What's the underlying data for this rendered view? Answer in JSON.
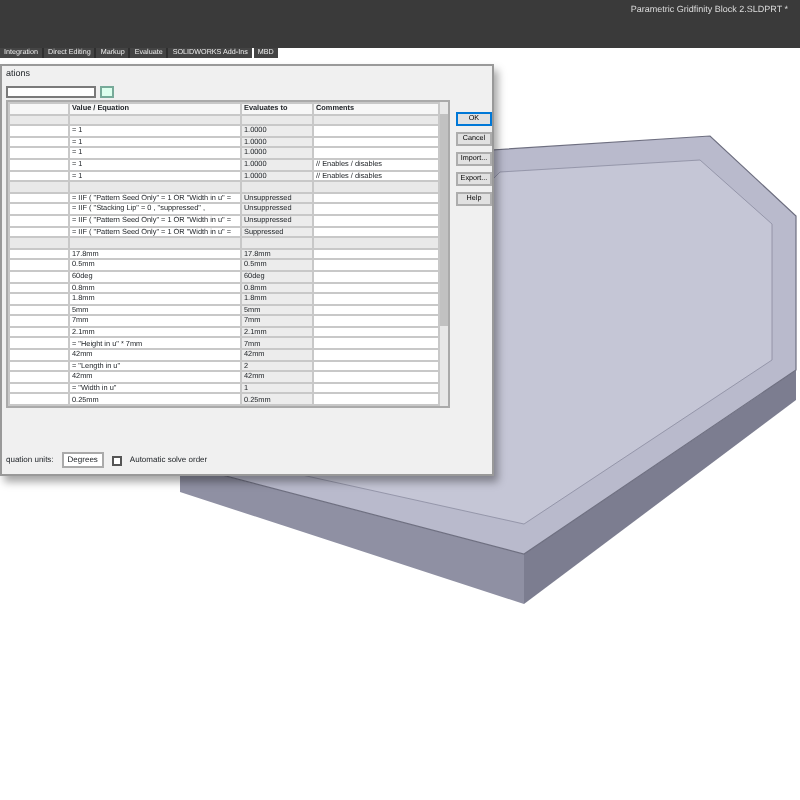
{
  "app": {
    "title": "Parametric Gridfinity Block 2.SLDPRT *"
  },
  "tabs": [
    "Integration",
    "Direct Editing",
    "Markup",
    "Evaluate",
    "SOLIDWORKS Add-Ins",
    "MBD"
  ],
  "dialog": {
    "title": "ations",
    "columns": [
      "Value / Equation",
      "Evaluates to",
      "Comments"
    ],
    "rows": [
      {
        "kind": "section"
      },
      {
        "kind": "row",
        "equation": "= 1",
        "evaluates": "1.0000",
        "comment": ""
      },
      {
        "kind": "row",
        "equation": "= 1",
        "evaluates": "1.0000",
        "comment": ""
      },
      {
        "kind": "row",
        "equation": "= 1",
        "evaluates": "1.0000",
        "comment": ""
      },
      {
        "kind": "row",
        "equation": "= 1",
        "evaluates": "1.0000",
        "comment": "// Enables / disables"
      },
      {
        "kind": "row",
        "equation": "= 1",
        "evaluates": "1.0000",
        "comment": "// Enables / disables"
      },
      {
        "kind": "section"
      },
      {
        "kind": "row",
        "equation": "= IIF ( \"Pattern Seed Only\" = 1 OR \"Width in u\" =",
        "evaluates": "Unsuppressed",
        "comment": ""
      },
      {
        "kind": "row",
        "equation": "= IIF ( \"Stacking Lip\" = 0 , \"suppressed\" ,",
        "evaluates": "Unsuppressed",
        "comment": ""
      },
      {
        "kind": "row",
        "equation": "= IIF ( \"Pattern Seed Only\" = 1 OR \"Width in u\" =",
        "evaluates": "Unsuppressed",
        "comment": ""
      },
      {
        "kind": "row",
        "equation": "= IIF ( \"Pattern Seed Only\" = 1 OR \"Width in u\" =",
        "evaluates": "Suppressed",
        "comment": ""
      },
      {
        "kind": "section"
      },
      {
        "kind": "row",
        "equation": "17.8mm",
        "evaluates": "17.8mm",
        "comment": ""
      },
      {
        "kind": "row",
        "equation": "0.5mm",
        "evaluates": "0.5mm",
        "comment": ""
      },
      {
        "kind": "row",
        "equation": "60deg",
        "evaluates": "60deg",
        "comment": ""
      },
      {
        "kind": "row",
        "equation": "0.8mm",
        "evaluates": "0.8mm",
        "comment": ""
      },
      {
        "kind": "row",
        "equation": "1.8mm",
        "evaluates": "1.8mm",
        "comment": ""
      },
      {
        "kind": "row",
        "equation": "5mm",
        "evaluates": "5mm",
        "comment": ""
      },
      {
        "kind": "row",
        "equation": "7mm",
        "evaluates": "7mm",
        "comment": ""
      },
      {
        "kind": "row",
        "equation": "2.1mm",
        "evaluates": "2.1mm",
        "comment": ""
      },
      {
        "kind": "row",
        "equation": "= \"Height in u\" * 7mm",
        "evaluates": "7mm",
        "comment": ""
      },
      {
        "kind": "row",
        "equation": "42mm",
        "evaluates": "42mm",
        "comment": ""
      },
      {
        "kind": "row",
        "equation": "= \"Length in u\"",
        "evaluates": "2",
        "comment": ""
      },
      {
        "kind": "row",
        "equation": "42mm",
        "evaluates": "42mm",
        "comment": ""
      },
      {
        "kind": "row",
        "equation": "= \"Width in u\"",
        "evaluates": "1",
        "comment": ""
      },
      {
        "kind": "row",
        "equation": "0.25mm",
        "evaluates": "0.25mm",
        "comment": ""
      }
    ],
    "buttons": [
      "OK",
      "Cancel",
      "Import...",
      "Export...",
      "Help"
    ],
    "units_label": "quation units:",
    "units": "Degrees",
    "auto_solve": {
      "label": "Automatic solve order",
      "checked": false
    }
  }
}
